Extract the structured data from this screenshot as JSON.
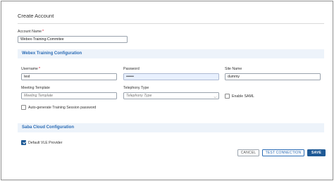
{
  "dialog": {
    "title": "Create Account"
  },
  "account_name": {
    "label": "Account Name",
    "required_mark": "*",
    "value": "Webex-Training-Commitee"
  },
  "webex_section": {
    "title": "Webex Training Configuration"
  },
  "username": {
    "label": "Username",
    "required_mark": "*",
    "value": "test"
  },
  "password": {
    "label": "Password",
    "value": "••••••"
  },
  "site_name": {
    "label": "Site Name",
    "value": "dummy"
  },
  "meeting_template": {
    "label": "Meeting Template",
    "placeholder": "Meeting Template"
  },
  "telephony_type": {
    "label": "Telephony Type",
    "selected": "Telephony Type"
  },
  "enable_saml": {
    "label": "Enable SAML",
    "checked": false
  },
  "auto_generate": {
    "label": "Auto-generate Training Session password",
    "checked": false
  },
  "saba_section": {
    "title": "Saba Cloud Configuration"
  },
  "default_vle": {
    "label": "Default VLE Provider",
    "checked": true
  },
  "buttons": {
    "cancel": "CANCEL",
    "test_connection": "TEST CONNECTION",
    "save": "SAVE"
  }
}
